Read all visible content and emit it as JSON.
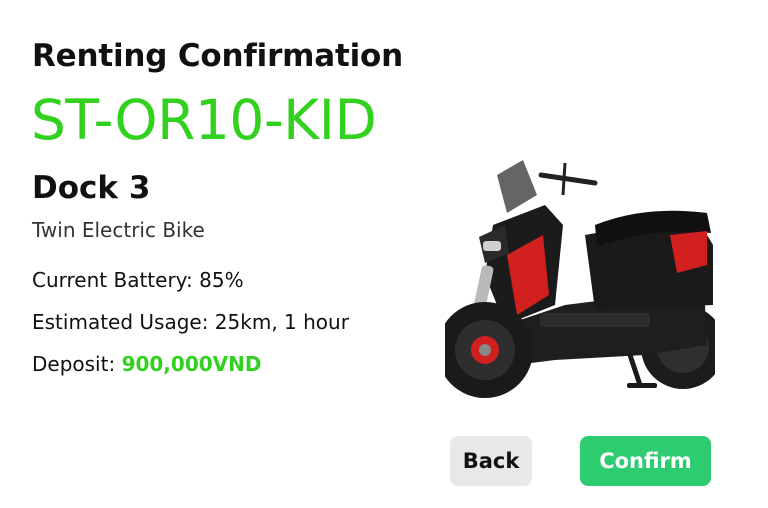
{
  "header": {
    "title": "Renting Confirmation"
  },
  "bike": {
    "code": "ST-OR10-KID",
    "dock": "Dock 3",
    "type": "Twin Electric Bike",
    "image_name": "electric-scooter-image"
  },
  "details": {
    "battery": "Current Battery: 85%",
    "usage": "Estimated Usage: 25km, 1 hour",
    "deposit_label": "Deposit: ",
    "deposit_value": "900,000VND"
  },
  "actions": {
    "back_label": "Back",
    "confirm_label": "Confirm"
  },
  "colors": {
    "accent_green": "#33d11f",
    "confirm_button": "#2ecc71",
    "back_button": "#e8e8e8"
  }
}
